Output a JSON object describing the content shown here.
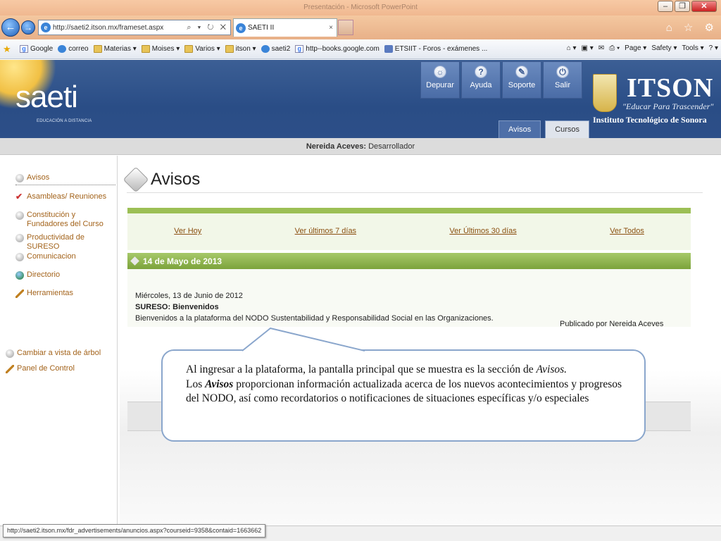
{
  "window": {
    "title": "Presentación - Microsoft PowerPoint"
  },
  "browser": {
    "address": "http://saeti2.itson.mx/frameset.aspx",
    "address_controls": "⌕ ▾ ↻ ✕",
    "tab_title": "SAETI II",
    "tab_close": "×",
    "right_icons": "⌂ ☆ ⚙",
    "favorites": [
      {
        "label": "Google",
        "icon": "g-icon"
      },
      {
        "label": "correo",
        "icon": "ie-page-icon"
      },
      {
        "label": "Materias ▾",
        "icon": "folder-icon"
      },
      {
        "label": "Moises ▾",
        "icon": "folder-icon"
      },
      {
        "label": "Varios ▾",
        "icon": "folder-icon"
      },
      {
        "label": "itson ▾",
        "icon": "folder-icon"
      },
      {
        "label": "saeti2",
        "icon": "ie-page-icon"
      },
      {
        "label": "http--books.google.com",
        "icon": "g-icon"
      },
      {
        "label": "ETSIIT - Foros - exámenes ...",
        "icon": "site-icon"
      }
    ],
    "toolbar": {
      "home": "⌂ ▾",
      "feeds": "▣ ▾",
      "mail": "✉",
      "print": "⎙ ▾",
      "page": "Page ▾",
      "safety": "Safety ▾",
      "tools": "Tools ▾",
      "help": "? ▾"
    }
  },
  "app": {
    "logo": "saeti",
    "logo_sub": "EDUCACIÓN A DISTANCIA",
    "top_buttons": [
      {
        "label": "Depurar",
        "glyph": "☼"
      },
      {
        "label": "Ayuda",
        "glyph": "?"
      },
      {
        "label": "Soporte",
        "glyph": "✎"
      },
      {
        "label": "Salir",
        "glyph": "⏻"
      }
    ],
    "tabs": [
      {
        "label": "Avisos"
      },
      {
        "label": "Cursos"
      }
    ],
    "institution": {
      "name": "ITSON",
      "motto": "\"Educar Para Trascender\"",
      "full_name": "Instituto Tecnológico de Sonora"
    },
    "user": {
      "name": "Nereida Aceves:",
      "role": "Desarrollador"
    }
  },
  "sidebar": {
    "items": [
      {
        "label": "Avisos"
      },
      {
        "label": "Asambleas/ Reuniones"
      },
      {
        "label": "Constitución y Fundadores del Curso"
      },
      {
        "label": "Productividad de SURESO"
      },
      {
        "label": "Comunicacion"
      },
      {
        "label": "Directorio"
      },
      {
        "label": "Herramientas"
      }
    ],
    "bottom": [
      {
        "label": "Cambiar a vista de árbol"
      },
      {
        "label": "Panel de Control"
      }
    ]
  },
  "main": {
    "title": "Avisos",
    "filters": [
      "Ver Hoy",
      "Ver últimos 7 días",
      "Ver Últimos 30 días",
      "Ver Todos"
    ],
    "date_header": "14 de Mayo de 2013",
    "notice": {
      "date": "Miércoles, 13 de Junio de 2012",
      "title": "SURESO: Bienvenidos",
      "body": "Bienvenidos a la plataforma del NODO Sustentabilidad y Responsabilidad Social en las Organizaciones.",
      "published_by": "Publicado por Nereida Aceves"
    }
  },
  "callout": {
    "line1": "Al ingresar a la plataforma, la pantalla principal que se muestra es la sección de",
    "line1_italic": "Avisos.",
    "line2_prefix": "Los",
    "line2_bold": "Avisos",
    "line2_rest": "proporcionan información actualizada acerca de los nuevos acontecimientos y progresos del NODO, así como recordatorios o notificaciones de situaciones específicas y/o especiales"
  },
  "status": {
    "url": "http://saeti2.itson.mx/fdr_advertisements/anuncios.aspx?courseid=9358&contaid=1663662"
  }
}
